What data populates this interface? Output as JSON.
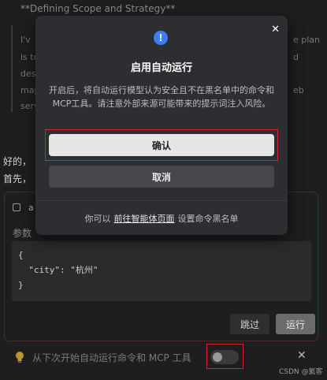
{
  "background": {
    "heading": "**Defining Scope and Strategy**",
    "quote_lines": [
      {
        "left": "I'v",
        "right": "e plan"
      },
      {
        "left": "is to",
        "right": "d"
      },
      {
        "left": "des",
        "right": ""
      },
      {
        "left": "map",
        "right": "eb"
      },
      {
        "left": "serv",
        "right": ""
      }
    ],
    "text_line_1": "好的，",
    "text_line_2": "首先，",
    "tool_card": {
      "tool_name": "a",
      "params_label": "参数",
      "code": "{\n  \"city\": \"杭州\"\n}",
      "skip_label": "跳过",
      "run_label": "运行"
    },
    "auto_bar": {
      "label": "从下次开始自动运行命令和 MCP 工具",
      "toggle_on": false,
      "close_label": "✕"
    },
    "watermark": "CSDN @氦客"
  },
  "modal": {
    "close_label": "✕",
    "icon_glyph": "!",
    "title": "启用自动运行",
    "description": "开启后，将自动运行模型认为安全且不在黑名单中的命令和MCP工具。请注意外部来源可能带来的提示词注入风险。",
    "confirm_label": "确认",
    "cancel_label": "取消",
    "footer_prefix": "你可以",
    "footer_link": "前往智能体页面",
    "footer_suffix": "设置命令黑名单"
  },
  "colors": {
    "accent_blue": "#3e7cf6",
    "highlight_red": "#d0252e",
    "modal_bg": "#2d2e31",
    "page_bg": "#1e1e1e"
  }
}
